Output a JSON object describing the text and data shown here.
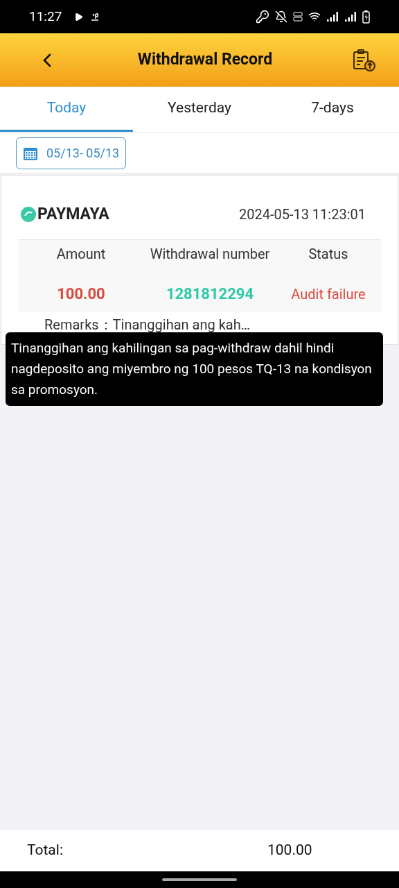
{
  "status_bar": {
    "time": "11:27"
  },
  "header": {
    "title": "Withdrawal Record"
  },
  "tabs": [
    {
      "label": "Today",
      "selected": true
    },
    {
      "label": "Yesterday",
      "selected": false
    },
    {
      "label": "7-days",
      "selected": false
    }
  ],
  "date_range": "05/13- 05/13",
  "records": [
    {
      "method": "PAYMAYA",
      "datetime": "2024-05-13 11:23:01",
      "columns": [
        "Amount",
        "Withdrawal number",
        "Status"
      ],
      "amount": "100.00",
      "number": "1281812294",
      "status": "Audit failure",
      "remarks_label": "Remarks：",
      "remarks": "Tinanggihan ang kah…"
    }
  ],
  "tooltip": "Tinanggihan ang kahilingan sa pag-withdraw dahil hindi nagdeposito ang miyembro ng 100 pesos TQ-13 na kondisyon sa promosyon.",
  "footer": {
    "label": "Total:",
    "value": "100.00"
  }
}
